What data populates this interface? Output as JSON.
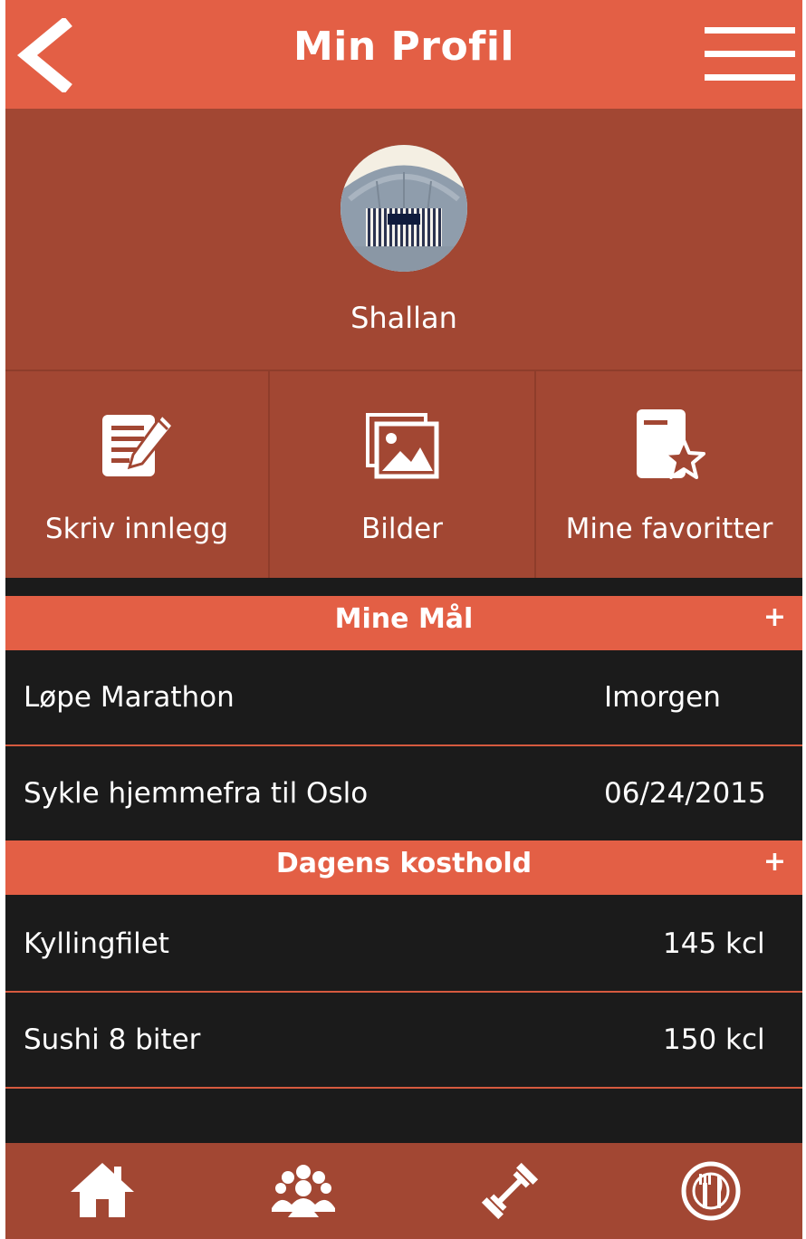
{
  "header": {
    "title": "Min Profil"
  },
  "profile": {
    "username": "Shallan"
  },
  "actions": [
    {
      "label": "Skriv innlegg",
      "icon": "write-post-icon"
    },
    {
      "label": "Bilder",
      "icon": "pictures-icon"
    },
    {
      "label": "Mine favoritter",
      "icon": "favorites-icon"
    }
  ],
  "goals": {
    "title": "Mine Mål",
    "add_label": "+",
    "items": [
      {
        "name": "Løpe Marathon",
        "when": "Imorgen"
      },
      {
        "name": "Sykle hjemmefra til Oslo",
        "when": "06/24/2015"
      }
    ]
  },
  "diet": {
    "title": "Dagens kosthold",
    "add_label": "+",
    "items": [
      {
        "name": "Kyllingfilet",
        "kcal": "145 kcl"
      },
      {
        "name": "Sushi 8 biter",
        "kcal": "150 kcl"
      }
    ]
  },
  "nav": [
    {
      "icon": "home-icon"
    },
    {
      "icon": "group-icon"
    },
    {
      "icon": "dumbbell-icon"
    },
    {
      "icon": "plate-cutlery-icon"
    }
  ],
  "colors": {
    "accent": "#e35f45",
    "panel": "#a24733",
    "background": "#1b1b1b",
    "text": "#ffffff"
  }
}
